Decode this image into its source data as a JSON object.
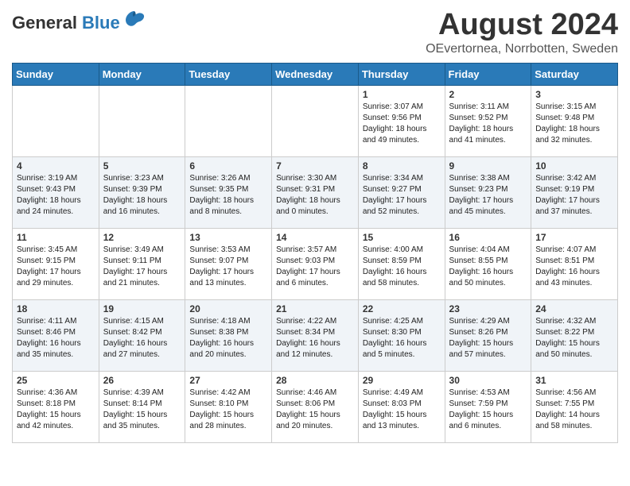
{
  "header": {
    "title": "August 2024",
    "subtitle": "OEvertornea, Norrbotten, Sweden",
    "logo_general": "General",
    "logo_blue": "Blue"
  },
  "days_of_week": [
    "Sunday",
    "Monday",
    "Tuesday",
    "Wednesday",
    "Thursday",
    "Friday",
    "Saturday"
  ],
  "weeks": [
    [
      {
        "day": "",
        "info": ""
      },
      {
        "day": "",
        "info": ""
      },
      {
        "day": "",
        "info": ""
      },
      {
        "day": "",
        "info": ""
      },
      {
        "day": "1",
        "info": "Sunrise: 3:07 AM\nSunset: 9:56 PM\nDaylight: 18 hours\nand 49 minutes."
      },
      {
        "day": "2",
        "info": "Sunrise: 3:11 AM\nSunset: 9:52 PM\nDaylight: 18 hours\nand 41 minutes."
      },
      {
        "day": "3",
        "info": "Sunrise: 3:15 AM\nSunset: 9:48 PM\nDaylight: 18 hours\nand 32 minutes."
      }
    ],
    [
      {
        "day": "4",
        "info": "Sunrise: 3:19 AM\nSunset: 9:43 PM\nDaylight: 18 hours\nand 24 minutes."
      },
      {
        "day": "5",
        "info": "Sunrise: 3:23 AM\nSunset: 9:39 PM\nDaylight: 18 hours\nand 16 minutes."
      },
      {
        "day": "6",
        "info": "Sunrise: 3:26 AM\nSunset: 9:35 PM\nDaylight: 18 hours\nand 8 minutes."
      },
      {
        "day": "7",
        "info": "Sunrise: 3:30 AM\nSunset: 9:31 PM\nDaylight: 18 hours\nand 0 minutes."
      },
      {
        "day": "8",
        "info": "Sunrise: 3:34 AM\nSunset: 9:27 PM\nDaylight: 17 hours\nand 52 minutes."
      },
      {
        "day": "9",
        "info": "Sunrise: 3:38 AM\nSunset: 9:23 PM\nDaylight: 17 hours\nand 45 minutes."
      },
      {
        "day": "10",
        "info": "Sunrise: 3:42 AM\nSunset: 9:19 PM\nDaylight: 17 hours\nand 37 minutes."
      }
    ],
    [
      {
        "day": "11",
        "info": "Sunrise: 3:45 AM\nSunset: 9:15 PM\nDaylight: 17 hours\nand 29 minutes."
      },
      {
        "day": "12",
        "info": "Sunrise: 3:49 AM\nSunset: 9:11 PM\nDaylight: 17 hours\nand 21 minutes."
      },
      {
        "day": "13",
        "info": "Sunrise: 3:53 AM\nSunset: 9:07 PM\nDaylight: 17 hours\nand 13 minutes."
      },
      {
        "day": "14",
        "info": "Sunrise: 3:57 AM\nSunset: 9:03 PM\nDaylight: 17 hours\nand 6 minutes."
      },
      {
        "day": "15",
        "info": "Sunrise: 4:00 AM\nSunset: 8:59 PM\nDaylight: 16 hours\nand 58 minutes."
      },
      {
        "day": "16",
        "info": "Sunrise: 4:04 AM\nSunset: 8:55 PM\nDaylight: 16 hours\nand 50 minutes."
      },
      {
        "day": "17",
        "info": "Sunrise: 4:07 AM\nSunset: 8:51 PM\nDaylight: 16 hours\nand 43 minutes."
      }
    ],
    [
      {
        "day": "18",
        "info": "Sunrise: 4:11 AM\nSunset: 8:46 PM\nDaylight: 16 hours\nand 35 minutes."
      },
      {
        "day": "19",
        "info": "Sunrise: 4:15 AM\nSunset: 8:42 PM\nDaylight: 16 hours\nand 27 minutes."
      },
      {
        "day": "20",
        "info": "Sunrise: 4:18 AM\nSunset: 8:38 PM\nDaylight: 16 hours\nand 20 minutes."
      },
      {
        "day": "21",
        "info": "Sunrise: 4:22 AM\nSunset: 8:34 PM\nDaylight: 16 hours\nand 12 minutes."
      },
      {
        "day": "22",
        "info": "Sunrise: 4:25 AM\nSunset: 8:30 PM\nDaylight: 16 hours\nand 5 minutes."
      },
      {
        "day": "23",
        "info": "Sunrise: 4:29 AM\nSunset: 8:26 PM\nDaylight: 15 hours\nand 57 minutes."
      },
      {
        "day": "24",
        "info": "Sunrise: 4:32 AM\nSunset: 8:22 PM\nDaylight: 15 hours\nand 50 minutes."
      }
    ],
    [
      {
        "day": "25",
        "info": "Sunrise: 4:36 AM\nSunset: 8:18 PM\nDaylight: 15 hours\nand 42 minutes."
      },
      {
        "day": "26",
        "info": "Sunrise: 4:39 AM\nSunset: 8:14 PM\nDaylight: 15 hours\nand 35 minutes."
      },
      {
        "day": "27",
        "info": "Sunrise: 4:42 AM\nSunset: 8:10 PM\nDaylight: 15 hours\nand 28 minutes."
      },
      {
        "day": "28",
        "info": "Sunrise: 4:46 AM\nSunset: 8:06 PM\nDaylight: 15 hours\nand 20 minutes."
      },
      {
        "day": "29",
        "info": "Sunrise: 4:49 AM\nSunset: 8:03 PM\nDaylight: 15 hours\nand 13 minutes."
      },
      {
        "day": "30",
        "info": "Sunrise: 4:53 AM\nSunset: 7:59 PM\nDaylight: 15 hours\nand 6 minutes."
      },
      {
        "day": "31",
        "info": "Sunrise: 4:56 AM\nSunset: 7:55 PM\nDaylight: 14 hours\nand 58 minutes."
      }
    ]
  ]
}
